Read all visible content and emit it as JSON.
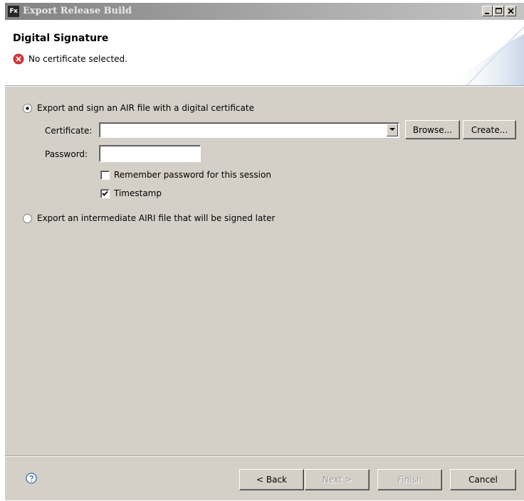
{
  "window": {
    "title": "Export Release Build",
    "app_icon_text": "Fx"
  },
  "header": {
    "title": "Digital Signature",
    "message": "No certificate selected.",
    "message_icon": "error-icon"
  },
  "options": {
    "sign_now": {
      "label": "Export and sign an AIR file with a digital certificate",
      "selected": true
    },
    "sign_later": {
      "label": "Export an intermediate AIRI file that will be signed later",
      "selected": false
    }
  },
  "certificate": {
    "label": "Certificate:",
    "value": "",
    "browse_label": "Browse...",
    "create_label": "Create..."
  },
  "password": {
    "label": "Password:",
    "value": ""
  },
  "remember_password": {
    "label": "Remember password for this session",
    "checked": false
  },
  "timestamp": {
    "label": "Timestamp",
    "checked": true
  },
  "footer": {
    "help_icon": "help-icon",
    "back_label": "< Back",
    "next_label": "Next >",
    "finish_label": "Finish",
    "cancel_label": "Cancel"
  },
  "colors": {
    "dialog_bg": "#d4d0c8",
    "header_bg": "#ffffff",
    "error_red": "#d9373b",
    "help_blue": "#3a6ea5"
  }
}
